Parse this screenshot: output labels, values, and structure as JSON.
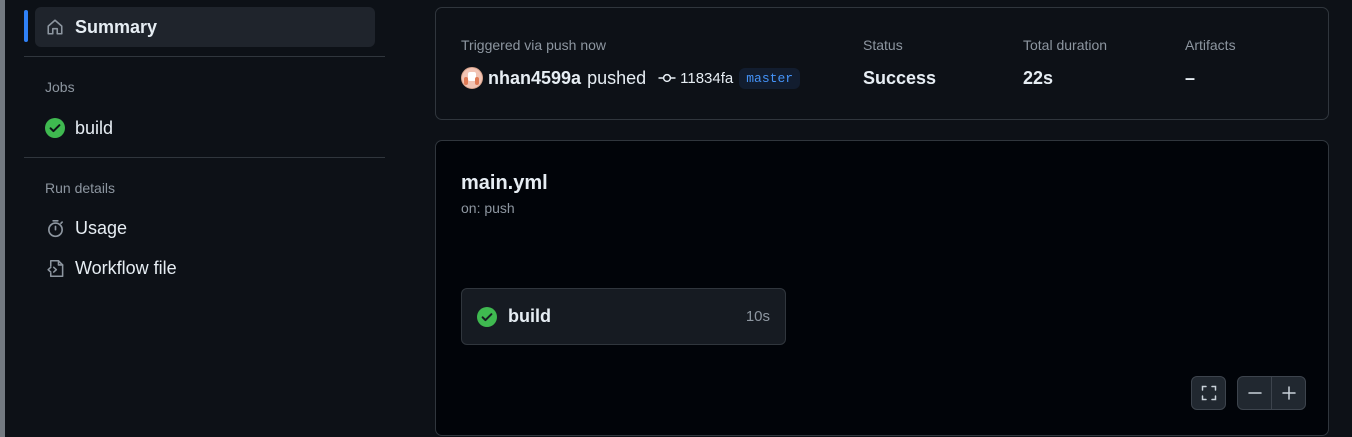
{
  "sidebar": {
    "summary_label": "Summary",
    "jobs_heading": "Jobs",
    "jobs": [
      {
        "label": "build",
        "status": "success"
      }
    ],
    "run_details_heading": "Run details",
    "usage_label": "Usage",
    "workflow_file_label": "Workflow file"
  },
  "summary": {
    "trigger_text": "Triggered via push now",
    "actor": "nhan4599a",
    "action": "pushed",
    "commit_sha": "11834fa",
    "branch": "master",
    "status_label": "Status",
    "status_value": "Success",
    "duration_label": "Total duration",
    "duration_value": "22s",
    "artifacts_label": "Artifacts",
    "artifacts_value": "–"
  },
  "graph": {
    "workflow_name": "main.yml",
    "trigger": "on: push",
    "job": {
      "name": "build",
      "duration": "10s",
      "status": "success"
    }
  },
  "colors": {
    "background": "#0d1117",
    "success": "#3fb950",
    "accent": "#2f81f7",
    "branch_text": "#4493f8"
  },
  "icons": {
    "summary": "home-icon",
    "job_status": "check-circle-fill-icon",
    "usage": "stopwatch-icon",
    "workflow_file": "file-code-icon",
    "commit": "git-commit-icon",
    "fullscreen": "screen-full-icon",
    "zoom_out": "dash-icon",
    "zoom_in": "plus-icon"
  }
}
